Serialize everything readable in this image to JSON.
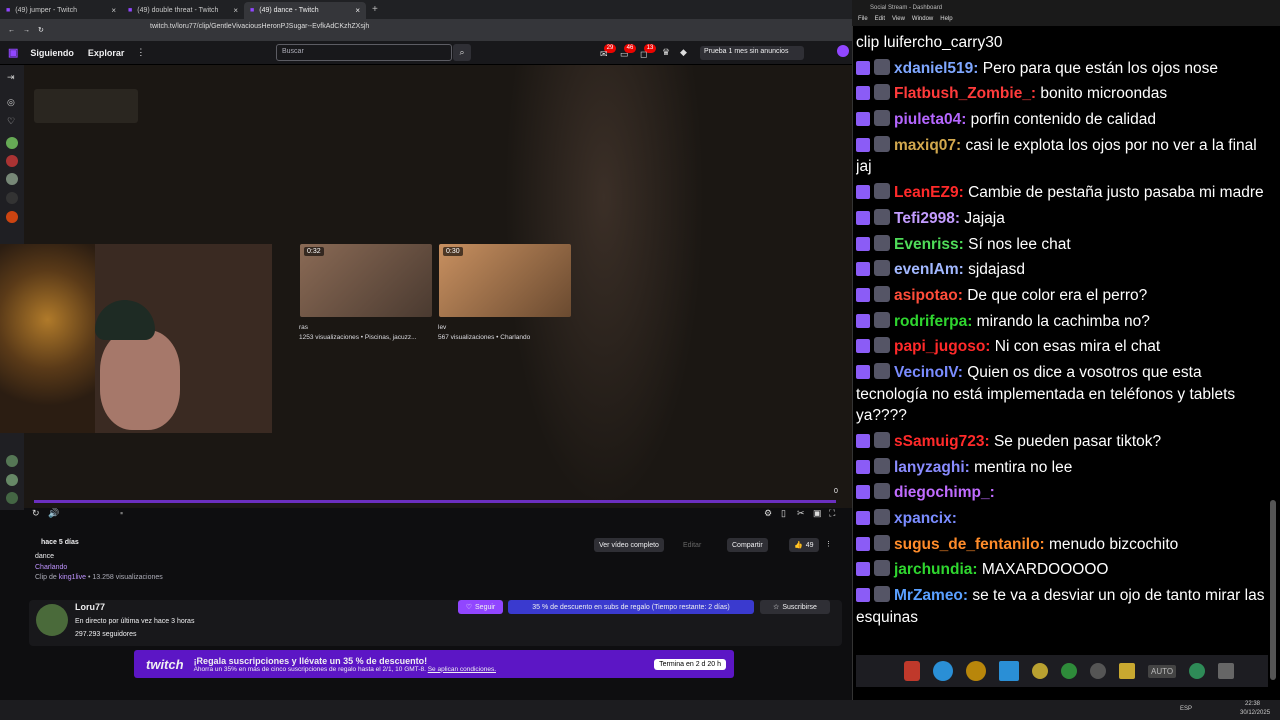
{
  "browser": {
    "tabs": [
      {
        "label": "(49) jumper - Twitch"
      },
      {
        "label": "(49) double threat - Twitch"
      },
      {
        "label": "(49) dance - Twitch"
      }
    ],
    "url": "twitch.tv/loru77/clip/GentleVivaciousHeronPJSugar--EvfkAdCKzhZXsjh",
    "new_tab": "+"
  },
  "nav": {
    "following": "Siguiendo",
    "explore": "Explorar",
    "more": "⋮",
    "search_placeholder": "Buscar",
    "badge1": "29",
    "badge2": "46",
    "badge3": "13",
    "promo": "Prueba 1 mes sin anuncios"
  },
  "thumbs": [
    {
      "duration": "0:32",
      "title": "ras",
      "meta": "1253 visualizaciones • Piscinas, jacuzz..."
    },
    {
      "duration": "0:30",
      "title": "lev",
      "meta": "567 visualizaciones • Charlando"
    }
  ],
  "player": {
    "count": "0"
  },
  "clip": {
    "ago": "hace 5 días",
    "title": "dance",
    "category": "Charlando",
    "clip_by_prefix": "Clip de",
    "clip_by": "king1live",
    "views": "• 13.258 visualizaciones"
  },
  "actions": {
    "full": "Ver vídeo completo",
    "edit": "Editar",
    "share": "Compartir",
    "likes": "49",
    "more": "⋮"
  },
  "channel": {
    "name": "Loru77",
    "status": "En directo por última vez hace 3 horas",
    "followers": "297.293 seguidores",
    "follow": "Seguir",
    "discount": "35 % de descuento en subs de regalo (Tiempo restante: 2 días)",
    "subscribe": "Suscribirse"
  },
  "banner": {
    "brand": "twitch",
    "headline": "¡Regala suscripciones y llévate un 35 % de descuento!",
    "sub": "Ahorra un 35% en más de cinco suscripciones de regalo hasta el 2/1, 10 GMT-8.",
    "link": "Se aplican condiciones.",
    "timer": "Termina en 2 d 20 h"
  },
  "panel": {
    "title": "Social Stream - Dashboard",
    "menu": [
      "File",
      "Edit",
      "View",
      "Window",
      "Help"
    ],
    "auto": "AUTO",
    "clock": "22:38",
    "date": "30/12/2025",
    "lang": "ESP"
  },
  "chat": [
    {
      "name": "",
      "text": "clip luifercho_carry30",
      "color": "#ffffff",
      "icon": false
    },
    {
      "name": "xdaniel519:",
      "text": " Pero para que están los ojos nose",
      "color": "#7fa7ff",
      "icon": true
    },
    {
      "name": "Flatbush_Zombie_:",
      "text": " bonito microondas",
      "color": "#ff3b3b",
      "icon": true
    },
    {
      "name": "piuleta04:",
      "text": " porfin contenido de calidad",
      "color": "#b566ff",
      "icon": true
    },
    {
      "name": "maxiq07:",
      "text": " casi le explota los ojos por no ver a la final jaj",
      "color": "#d2a84e",
      "icon": true
    },
    {
      "name": "LeanEZ9:",
      "text": " Cambie de pestaña justo pasaba mi madre",
      "color": "#ff2a2a",
      "icon": true
    },
    {
      "name": "Tefi2998:",
      "text": " Jajaja",
      "color": "#c39cff",
      "icon": true
    },
    {
      "name": "Evenriss:",
      "text": " Sí nos lee chat",
      "color": "#4fdc59",
      "icon": true
    },
    {
      "name": "evenIAm:",
      "text": " sjdajasd",
      "color": "#a2b8ff",
      "icon": true
    },
    {
      "name": "asipotao:",
      "text": " De que color era el perro?",
      "color": "#ff4d3a",
      "icon": true
    },
    {
      "name": "rodriferpa:",
      "text": " mirando la cachimba no?",
      "color": "#2fd62f",
      "icon": true
    },
    {
      "name": "papi_jugoso:",
      "text": " Ni con esas mira el chat",
      "color": "#ff2a2a",
      "icon": true
    },
    {
      "name": "VecinoIV:",
      "text": " Quien os dice a vosotros que esta tecnología no está implementada en teléfonos y tablets ya????",
      "color": "#7a8cff",
      "icon": true
    },
    {
      "name": "sSamuig723:",
      "text": " Se pueden pasar tiktok?",
      "color": "#ff2a2a",
      "icon": true
    },
    {
      "name": "lanyzaghi:",
      "text": " mentira no lee",
      "color": "#8a8cff",
      "icon": true
    },
    {
      "name": "diegochimp_:",
      "text": "",
      "color": "#c06cff",
      "icon": true
    },
    {
      "name": "xpancix:",
      "text": "",
      "color": "#7a8cff",
      "icon": true
    },
    {
      "name": "sugus_de_fentanilo:",
      "text": " menudo bizcochito",
      "color": "#ff8c2a",
      "icon": true
    },
    {
      "name": "jarchundia:",
      "text": " MAXARDOOOOO",
      "color": "#2fd62f",
      "icon": true
    },
    {
      "name": "MrZameo:",
      "text": " se te va a desviar un ojo de tanto mirar las esquinas",
      "color": "#5aa0ff",
      "icon": true
    }
  ]
}
